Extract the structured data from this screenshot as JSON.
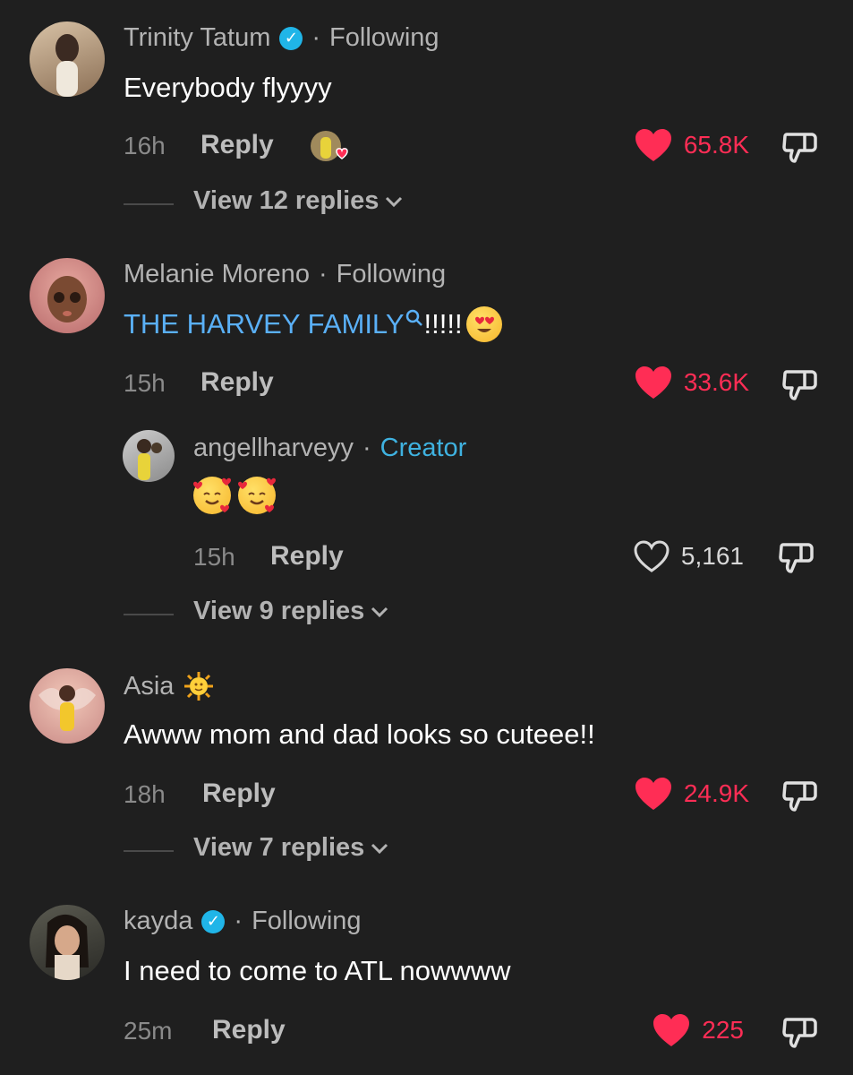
{
  "comments": [
    {
      "username": "Trinity Tatum",
      "verified": true,
      "relation": "Following",
      "text": "Everybody flyyyy",
      "time": "16h",
      "reply_label": "Reply",
      "likes": "65.8K",
      "view_replies": "View 12 replies"
    },
    {
      "username": "Melanie Moreno",
      "verified": false,
      "relation": "Following",
      "text_link": "THE HARVEY FAMILY",
      "text_rest": "!!!!!",
      "time": "15h",
      "reply_label": "Reply",
      "likes": "33.6K",
      "reply": {
        "username": "angellharveyy",
        "relation": "Creator",
        "time": "15h",
        "reply_label": "Reply",
        "likes": "5,161"
      },
      "view_replies": "View 9 replies"
    },
    {
      "username": "Asia",
      "text": "Awww mom and dad looks so cuteee!!",
      "time": "18h",
      "reply_label": "Reply",
      "likes": "24.9K",
      "view_replies": "View 7 replies"
    },
    {
      "username": "kayda",
      "verified": true,
      "relation": "Following",
      "text": "I need to come to ATL nowwww",
      "time": "25m",
      "reply_label": "Reply",
      "likes": "225"
    }
  ],
  "separator": "·",
  "colors": {
    "like_active": "#ff2d55",
    "creator": "#3fb2e0",
    "link": "#5ab0f7",
    "verified": "#20b5e8"
  }
}
